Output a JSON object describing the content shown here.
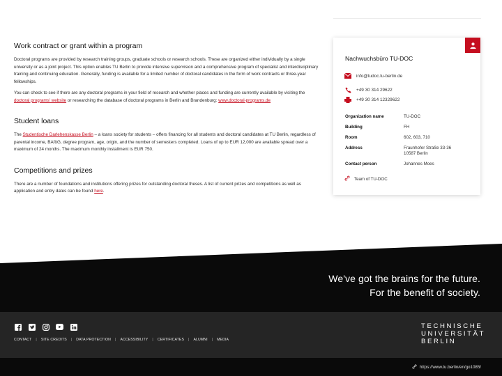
{
  "sections": [
    {
      "title": "Work contract or grant within a program",
      "paragraphs": [
        "Doctoral programs are provided by research training groups, graduate schools or research schools. These are organized either individually by a single university or as a joint project. This option enables TU Berlin to provide intensive supervision and a comprehensive program of specialist and interdisciplinary training and continuing education. Generally, funding is available for a limited number of doctoral candidates in the form of work contracts or three-year fellowships.",
        "You can check to see if there are any doctoral programs in your field of research and whether places and funding are currently available by visiting the "
      ],
      "link1": "doctoral programs' website",
      "mid": " or researching the database of doctoral programs in Berlin and Brandenburg: ",
      "link2": "www.doctoral-programs.de"
    },
    {
      "title": "Student loans",
      "pre": "The ",
      "link": "Studentische Darlehenskasse Berlin",
      "post": " – a loans society for students – offers financing for all students and doctoral candidates at TU Berlin, regardless of parental income, BAföG, degree program, age, origin, and the number of semesters completed. Loans of up to EUR 12,000 are available spread over a maximum of 24 months. The maximum monthly installment is EUR 750."
    },
    {
      "title": "Competitions and prizes",
      "pre": "There are a number of foundations and institutions offering prizes for outstanding doctoral theses. A list of current prizes and competitions as well as application and entry dates can be found ",
      "link": "here",
      "post": "."
    }
  ],
  "card": {
    "title": "Nachwuchsbüro TU-DOC",
    "email": "info@tudoc.tu-berlin.de",
    "phone1": "+49 30 314 29622",
    "phone2": "+49 30 314 12329622",
    "rows": [
      {
        "k": "Organization name",
        "v": "TU-DOC"
      },
      {
        "k": "Building",
        "v": "FH"
      },
      {
        "k": "Room",
        "v": "602, 603, 710"
      },
      {
        "k": "Address",
        "v": "Fraunhofer Straße 33-36\n10587 Berlin"
      },
      {
        "k": "Contact person",
        "v": "Johannes Moes"
      }
    ],
    "link": "Team of TU-DOC"
  },
  "footer": {
    "slogan1": "We've got the brains for the future.",
    "slogan2": "For the benefit of society.",
    "links": [
      "CONTACT",
      "SITE CREDITS",
      "DATA PROTECTION",
      "ACCESSIBILITY",
      "CERTIFICATES",
      "ALUMNI",
      "MEDIA"
    ],
    "logo": [
      "TECHNISCHE",
      "UNIVERSITÄT",
      "BERLIN"
    ],
    "url": "https://www.tu.berlin/en/go1085/"
  },
  "colors": {
    "accent": "#c50e1f",
    "footer_dark": "#0a0a0a",
    "footer_bar": "#252525"
  },
  "icons": [
    "user-badge-icon",
    "mail-icon",
    "phone-icon",
    "fax-icon",
    "link-icon",
    "facebook-icon",
    "twitter-icon",
    "instagram-icon",
    "youtube-icon",
    "linkedin-icon"
  ]
}
